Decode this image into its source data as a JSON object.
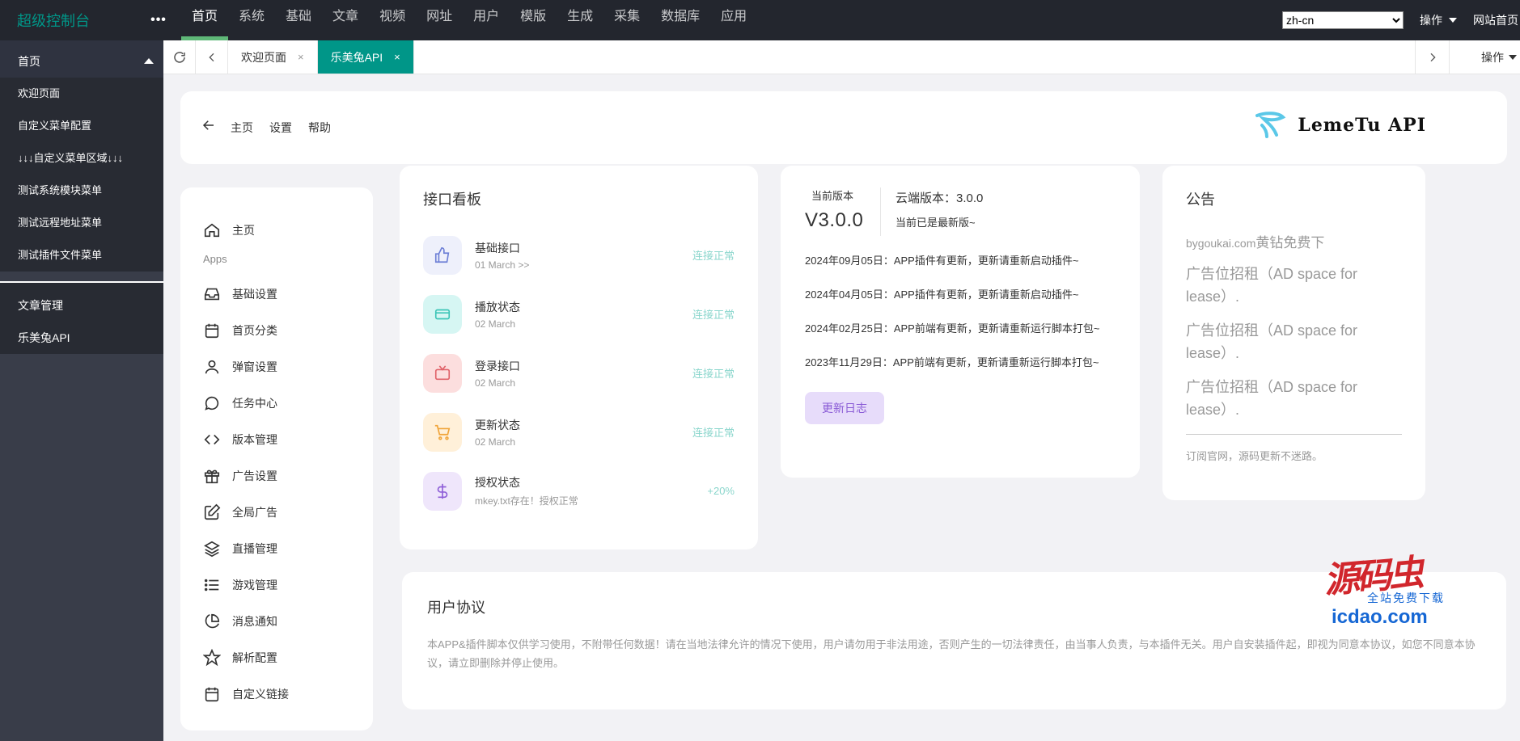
{
  "header": {
    "logo": "超级控制台",
    "more": "•••",
    "nav": [
      "首页",
      "系统",
      "基础",
      "文章",
      "视频",
      "网址",
      "用户",
      "模版",
      "生成",
      "采集",
      "数据库",
      "应用"
    ],
    "lang_value": "zh-cn",
    "ops_label": "操作",
    "site_home": "网站首页"
  },
  "sidebar": {
    "group": "首页",
    "sub_items": [
      "欢迎页面",
      "自定义菜单配置",
      "↓↓↓自定义菜单区域↓↓↓",
      "测试系统模块菜单",
      "测试远程地址菜单",
      "测试插件文件菜单"
    ],
    "main_items": [
      "文章管理",
      "乐美兔API"
    ]
  },
  "tabs": {
    "items": [
      {
        "label": "欢迎页面",
        "close": "×",
        "active": false
      },
      {
        "label": "乐美兔API",
        "close": "×",
        "active": true
      }
    ],
    "ops": "操作"
  },
  "topbar": {
    "crumbs": [
      "主页",
      "设置",
      "帮助"
    ],
    "brand": "LemeTu API"
  },
  "menu": {
    "home": "主页",
    "heading": "Apps",
    "items": [
      {
        "label": "基础设置",
        "icon": "inbox-icon"
      },
      {
        "label": "首页分类",
        "icon": "calendar-icon"
      },
      {
        "label": "弹窗设置",
        "icon": "user-icon"
      },
      {
        "label": "任务中心",
        "icon": "chat-icon"
      },
      {
        "label": "版本管理",
        "icon": "code-icon"
      },
      {
        "label": "广告设置",
        "icon": "gift-icon"
      },
      {
        "label": "全局广告",
        "icon": "edit-icon"
      },
      {
        "label": "直播管理",
        "icon": "layers-icon"
      },
      {
        "label": "游戏管理",
        "icon": "list-icon"
      },
      {
        "label": "消息通知",
        "icon": "pie-icon"
      },
      {
        "label": "解析配置",
        "icon": "star-icon"
      },
      {
        "label": "自定义链接",
        "icon": "calendar-icon"
      }
    ]
  },
  "api_board": {
    "title": "接口看板",
    "rows": [
      {
        "name": "基础接口",
        "sub": "01 March >>",
        "status": "连接正常",
        "icon": "thumbs-up-icon",
        "bg": "#eef0fb",
        "fg": "#6d7fd6"
      },
      {
        "name": "播放状态",
        "sub": "02 March",
        "status": "连接正常",
        "icon": "card-icon",
        "bg": "#d6f6f3",
        "fg": "#3cc5b7"
      },
      {
        "name": "登录接口",
        "sub": "02 March",
        "status": "连接正常",
        "icon": "tv-icon",
        "bg": "#fcdede",
        "fg": "#e0636a"
      },
      {
        "name": "更新状态",
        "sub": "02 March",
        "status": "连接正常",
        "icon": "cart-icon",
        "bg": "#fff0d9",
        "fg": "#f0a43a"
      },
      {
        "name": "授权状态",
        "sub": "mkey.txt存在！授权正常",
        "status": "+20%",
        "icon": "dollar-icon",
        "bg": "#efe6fb",
        "fg": "#8f5fd8"
      }
    ]
  },
  "version": {
    "current_label": "当前版本",
    "current": "V3.0.0",
    "cloud": "云端版本：3.0.0",
    "latest": "当前已是最新版~",
    "notes": [
      "2024年09月05日：APP插件有更新，更新请重新启动插件~",
      "2024年04月05日：APP插件有更新，更新请重新启动插件~",
      "2024年02月25日：APP前端有更新，更新请重新运行脚本打包~",
      "2023年11月29日：APP前端有更新，更新请重新运行脚本打包~"
    ],
    "log_button": "更新日志"
  },
  "notice": {
    "title": "公告",
    "line1_small": "bygoukai.com",
    "line1_big": "黄钻免费下",
    "ads": [
      "广告位招租（AD space for lease）.",
      "广告位招租（AD space for lease）.",
      "广告位招租（AD space for lease）."
    ],
    "footer": "订阅官网，源码更新不迷路。"
  },
  "agreement": {
    "title": "用户协议",
    "body": "本APP&插件脚本仅供学习使用，不附带任何数据！请在当地法律允许的情况下使用，用户请勿用于非法用途，否则产生的一切法律责任，由当事人负责，与本插件无关。用户自安装插件起，即视为同意本协议，如您不同意本协议，请立即删除并停止使用。"
  },
  "watermark": {
    "big": "源码虫",
    "small": "全站免费下载",
    "url": "icdao.com"
  }
}
